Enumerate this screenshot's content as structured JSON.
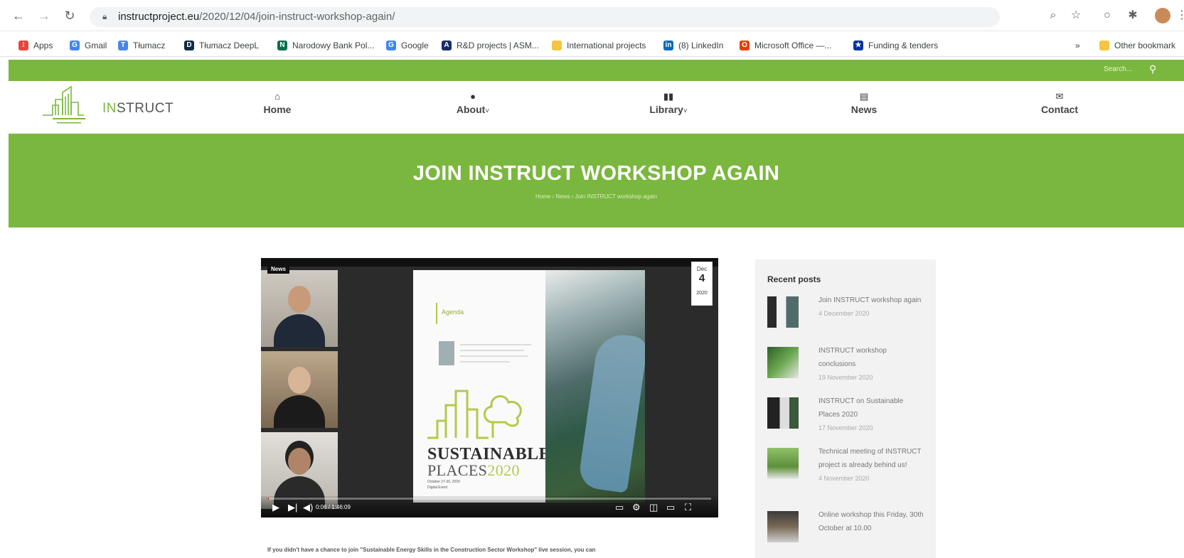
{
  "browser": {
    "url_domain": "instructproject.eu",
    "url_path": "/2020/12/04/join-instruct-workshop-again/",
    "bookmarks": [
      {
        "label": "Apps",
        "icon": "apps-grid-icon",
        "color": "#e8453c"
      },
      {
        "label": "Gmail",
        "icon": "google-icon",
        "color": "#4285f4"
      },
      {
        "label": "Tłumacz",
        "icon": "translate-icon",
        "color": "#4a86e8"
      },
      {
        "label": "Tłumacz DeepL",
        "icon": "deepl-icon",
        "color": "#0f2b46"
      },
      {
        "label": "Narodowy Bank Pol...",
        "icon": "nbp-icon",
        "color": "#0b6e4f"
      },
      {
        "label": "Google",
        "icon": "google-icon",
        "color": "#4285f4"
      },
      {
        "label": "R&D projects | ASM...",
        "icon": "asm-icon",
        "color": "#1b2a6b"
      },
      {
        "label": "International projects",
        "icon": "folder-icon",
        "color": "#f4c542"
      },
      {
        "label": "(8) LinkedIn",
        "icon": "linkedin-icon",
        "color": "#0a66c2"
      },
      {
        "label": "Microsoft Office —...",
        "icon": "office-icon",
        "color": "#eb3c00"
      },
      {
        "label": "Funding & tenders",
        "icon": "eu-flag-icon",
        "color": "#003399"
      }
    ],
    "other_bookmarks": "Other bookmark"
  },
  "site": {
    "search_label": "Search...",
    "logo_in": "IN",
    "logo_rest": "STRUCT",
    "nav": [
      {
        "label": "Home",
        "icon": "home-icon"
      },
      {
        "label": "About",
        "icon": "info-icon",
        "dropdown": true
      },
      {
        "label": "Library",
        "icon": "book-icon",
        "dropdown": true
      },
      {
        "label": "News",
        "icon": "newspaper-icon"
      },
      {
        "label": "Contact",
        "icon": "envelope-icon"
      }
    ],
    "nav_labels": {
      "home": "Home",
      "about": "About",
      "library": "Library",
      "news": "News",
      "contact": "Contact"
    },
    "colors": {
      "brand_green": "#7ab73e"
    }
  },
  "hero": {
    "title": "JOIN INSTRUCT WORKSHOP AGAIN",
    "breadcrumb": "Home  ›  News  ›  Join INSTRUCT workshop again"
  },
  "video": {
    "category_tag": "News",
    "date_month": "Dec",
    "date_day": "4",
    "date_year": "2020",
    "time": "0:06 / 1:46:09",
    "progress": 0.001,
    "slide": {
      "agenda": "Agenda",
      "title_line1": "SUSTAINABLE",
      "title_line2": "PLACES",
      "title_year": "2020",
      "dates": "October 27-30, 2020",
      "event": "Digital Event"
    }
  },
  "article": {
    "intro": "If you didn't have a chance to join \"Sustainable Energy Skills in the Construction Sector Workshop\" live session, you can"
  },
  "sidebar": {
    "title": "Recent posts",
    "posts": [
      {
        "title": "Join INSTRUCT workshop again",
        "date": "4 December 2020"
      },
      {
        "title": "INSTRUCT workshop conclusions",
        "date": "19 November 2020"
      },
      {
        "title": "INSTRUCT on Sustainable Places 2020",
        "date": "17 November 2020"
      },
      {
        "title": "Technical meeting of INSTRUCT project is already behind us!",
        "date": "4 November 2020"
      },
      {
        "title": "Online workshop this Friday, 30th October at 10.00",
        "date": ""
      }
    ]
  }
}
